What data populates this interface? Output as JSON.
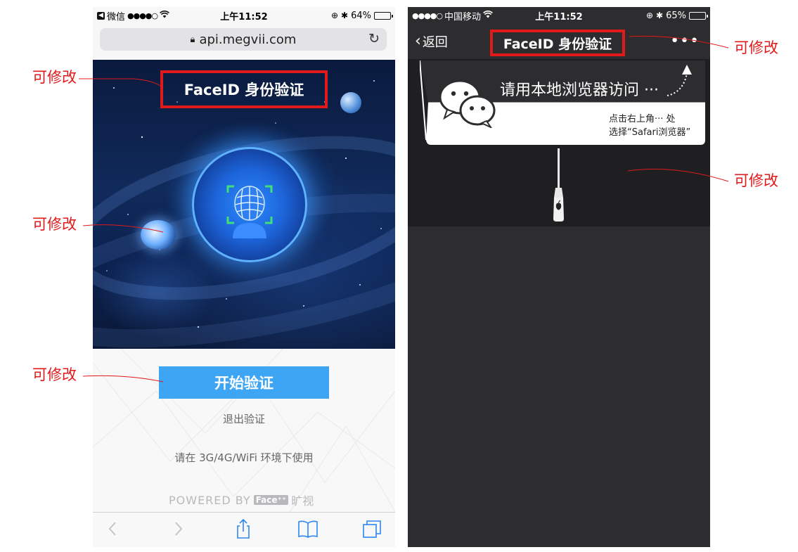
{
  "annotations": {
    "left_title": "可修改",
    "left_planet": "可修改",
    "left_button": "可修改",
    "right_title": "可修改",
    "right_body": "可修改"
  },
  "left_phone": {
    "status_bar": {
      "back_app": "微信",
      "signal": "●●●●○",
      "time": "上午11:52",
      "battery": "64%",
      "battery_level": 0.64
    },
    "url_bar": {
      "url": "api.megvii.com"
    },
    "hero": {
      "title": "FaceID 身份验证"
    },
    "start_button": "开始验证",
    "exit_link": "退出验证",
    "env_note": "请在 3G/4G/WiFi 环境下使用",
    "powered_by": "POWERED BY",
    "brand_badge": "Face⁺⁺",
    "brand_name": "旷视",
    "toolbar_icons": [
      "back-icon",
      "forward-icon",
      "share-icon",
      "bookmarks-icon",
      "tabs-icon"
    ]
  },
  "right_phone": {
    "status_bar": {
      "signal": "●●●●○",
      "carrier": "中国移动",
      "time": "上午11:52",
      "battery": "65%",
      "battery_level": 0.65
    },
    "nav": {
      "back_label": "返回",
      "title": "FaceID 身份验证",
      "more": "•••"
    },
    "guide": {
      "headline": "请用本地浏览器访问 ···",
      "line1": "点击右上角··· 处",
      "line2": "选择“Safari浏览器”"
    }
  },
  "colors": {
    "annotation_red": "#e0191b",
    "start_button_blue": "#3da5f4",
    "wechat_dark": "#2d2d30"
  }
}
